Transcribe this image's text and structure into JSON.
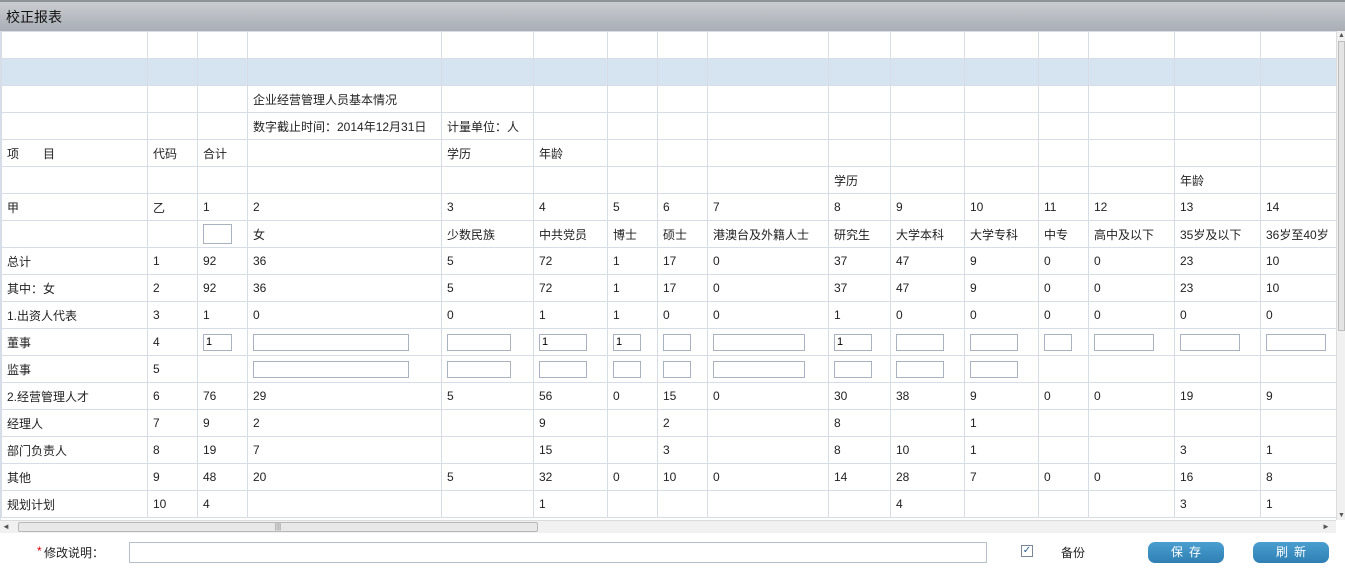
{
  "window": {
    "title": "校正报表"
  },
  "report": {
    "title": "企业经营管理人员基本情况",
    "date_label": "数字截止时间：2014年12月31日",
    "unit_label": "计量单位：人",
    "header1": {
      "item": "项　　目",
      "code": "代码",
      "total": "合计",
      "edu": "学历",
      "age": "年龄"
    },
    "header2": {
      "edu": "学历",
      "age": "年龄"
    },
    "index_row": [
      "甲",
      "乙",
      "1",
      "2",
      "3",
      "4",
      "5",
      "6",
      "7",
      "8",
      "9",
      "10",
      "11",
      "12",
      "13",
      "14"
    ],
    "col_headers": [
      "女",
      "少数民族",
      "中共党员",
      "博士",
      "硕士",
      "港澳台及外籍人士",
      "研究生",
      "大学本科",
      "大学专科",
      "中专",
      "高中及以下",
      "35岁及以下",
      "36岁至40岁"
    ],
    "rows": [
      {
        "name": "总计",
        "code": "1",
        "vals": [
          "92",
          "36",
          "5",
          "72",
          "1",
          "17",
          "0",
          "37",
          "47",
          "9",
          "0",
          "0",
          "23",
          "10"
        ]
      },
      {
        "name": "其中：女",
        "code": "2",
        "vals": [
          "92",
          "36",
          "5",
          "72",
          "1",
          "17",
          "0",
          "37",
          "47",
          "9",
          "0",
          "0",
          "23",
          "10"
        ]
      },
      {
        "name": "1.出资人代表",
        "code": "3",
        "vals": [
          "1",
          "0",
          "0",
          "1",
          "1",
          "0",
          "0",
          "1",
          "0",
          "0",
          "0",
          "0",
          "0",
          "0"
        ]
      },
      {
        "name": "董事",
        "code": "4",
        "inputs": {
          "c1": "1",
          "c4": "1",
          "c5": "1",
          "c8": "1"
        }
      },
      {
        "name": "监事",
        "code": "5"
      },
      {
        "name": "2.经营管理人才",
        "code": "6",
        "vals": [
          "76",
          "29",
          "5",
          "56",
          "0",
          "15",
          "0",
          "30",
          "38",
          "9",
          "0",
          "0",
          "19",
          "9"
        ]
      },
      {
        "name": "经理人",
        "code": "7",
        "vals": [
          "9",
          "2",
          "",
          "9",
          "",
          "2",
          "",
          "8",
          "",
          "1",
          "",
          "",
          "",
          ""
        ]
      },
      {
        "name": "部门负责人",
        "code": "8",
        "vals": [
          "19",
          "7",
          "",
          "15",
          "",
          "3",
          "",
          "8",
          "10",
          "1",
          "",
          "",
          "3",
          "1"
        ]
      },
      {
        "name": "其他",
        "code": "9",
        "vals": [
          "48",
          "20",
          "5",
          "32",
          "0",
          "10",
          "0",
          "14",
          "28",
          "7",
          "0",
          "0",
          "16",
          "8"
        ]
      },
      {
        "name": "规划计划",
        "code": "10",
        "vals": [
          "4",
          "",
          "",
          "1",
          "",
          "",
          "",
          "",
          "4",
          "",
          "",
          "",
          "3",
          "1"
        ]
      }
    ]
  },
  "footer": {
    "required_mark": "*",
    "note_label": "修改说明：",
    "backup_label": "备份",
    "backup_checked": "✓",
    "save_label": "保存",
    "refresh_label": "刷新"
  },
  "scrollbars": {
    "hscroll_grip": "|||",
    "up": "▲",
    "down": "▼",
    "left": "◄",
    "right": "►"
  }
}
